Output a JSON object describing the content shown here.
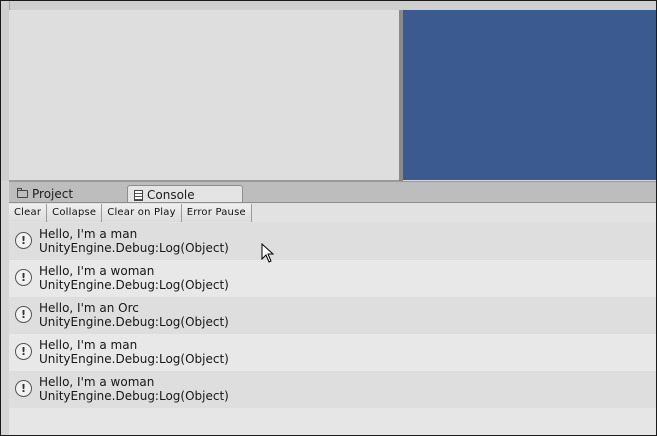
{
  "tabs": [
    {
      "label": "Project",
      "icon": "folder-icon"
    },
    {
      "label": "Console",
      "icon": "console-icon"
    }
  ],
  "toolbar": {
    "clear": "Clear",
    "collapse": "Collapse",
    "clear_on_play": "Clear on Play",
    "error_pause": "Error Pause"
  },
  "logs": [
    {
      "message": "Hello, I'm a man",
      "source": "UnityEngine.Debug:Log(Object)"
    },
    {
      "message": "Hello, I'm a woman",
      "source": "UnityEngine.Debug:Log(Object)"
    },
    {
      "message": "Hello, I'm an Orc",
      "source": "UnityEngine.Debug:Log(Object)"
    },
    {
      "message": "Hello, I'm a man",
      "source": "UnityEngine.Debug:Log(Object)"
    },
    {
      "message": "Hello, I'm a woman",
      "source": "UnityEngine.Debug:Log(Object)"
    }
  ],
  "colors": {
    "game_view": "#3b5a8f",
    "panel": "#dedede"
  }
}
